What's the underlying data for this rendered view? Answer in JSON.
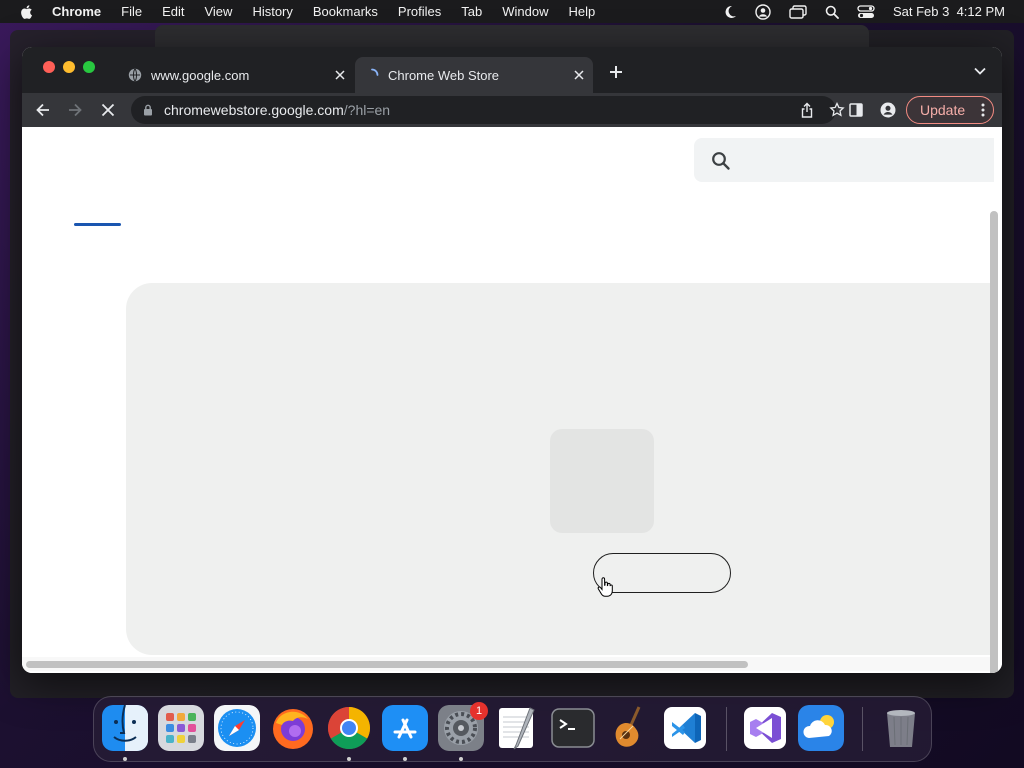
{
  "menubar": {
    "app_name": "Chrome",
    "items": [
      "File",
      "Edit",
      "View",
      "History",
      "Bookmarks",
      "Profiles",
      "Tab",
      "Window",
      "Help"
    ],
    "datetime": "Sat Feb 3  4:12 PM"
  },
  "browser": {
    "tabs": [
      {
        "title": "www.google.com",
        "active": false
      },
      {
        "title": "Chrome Web Store",
        "active": true
      }
    ],
    "url": {
      "host": "chromewebstore.google.com",
      "path": "/?hl=en"
    },
    "update_label": "Update",
    "loading": true
  },
  "page": {
    "search": {
      "placeholder": ""
    }
  },
  "dock": {
    "apps": [
      {
        "name": "finder-icon",
        "running": true
      },
      {
        "name": "launchpad-icon",
        "running": false
      },
      {
        "name": "safari-icon",
        "running": false
      },
      {
        "name": "firefox-icon",
        "running": false
      },
      {
        "name": "chrome-icon",
        "running": true
      },
      {
        "name": "app-store-icon",
        "running": true
      },
      {
        "name": "system-settings-icon",
        "running": true,
        "badge": "1"
      },
      {
        "name": "textedit-icon",
        "running": false
      },
      {
        "name": "terminal-icon",
        "running": false
      },
      {
        "name": "garageband-icon",
        "running": false
      },
      {
        "name": "vscode-icon",
        "running": false
      },
      {
        "name": "visual-studio-icon",
        "running": false
      },
      {
        "name": "weather-icon",
        "running": false
      },
      {
        "name": "trash-icon",
        "running": false
      }
    ]
  },
  "colors": {
    "accent": "#1a56b0",
    "update_border": "#f28b82",
    "card_bg": "#eff0ef"
  }
}
